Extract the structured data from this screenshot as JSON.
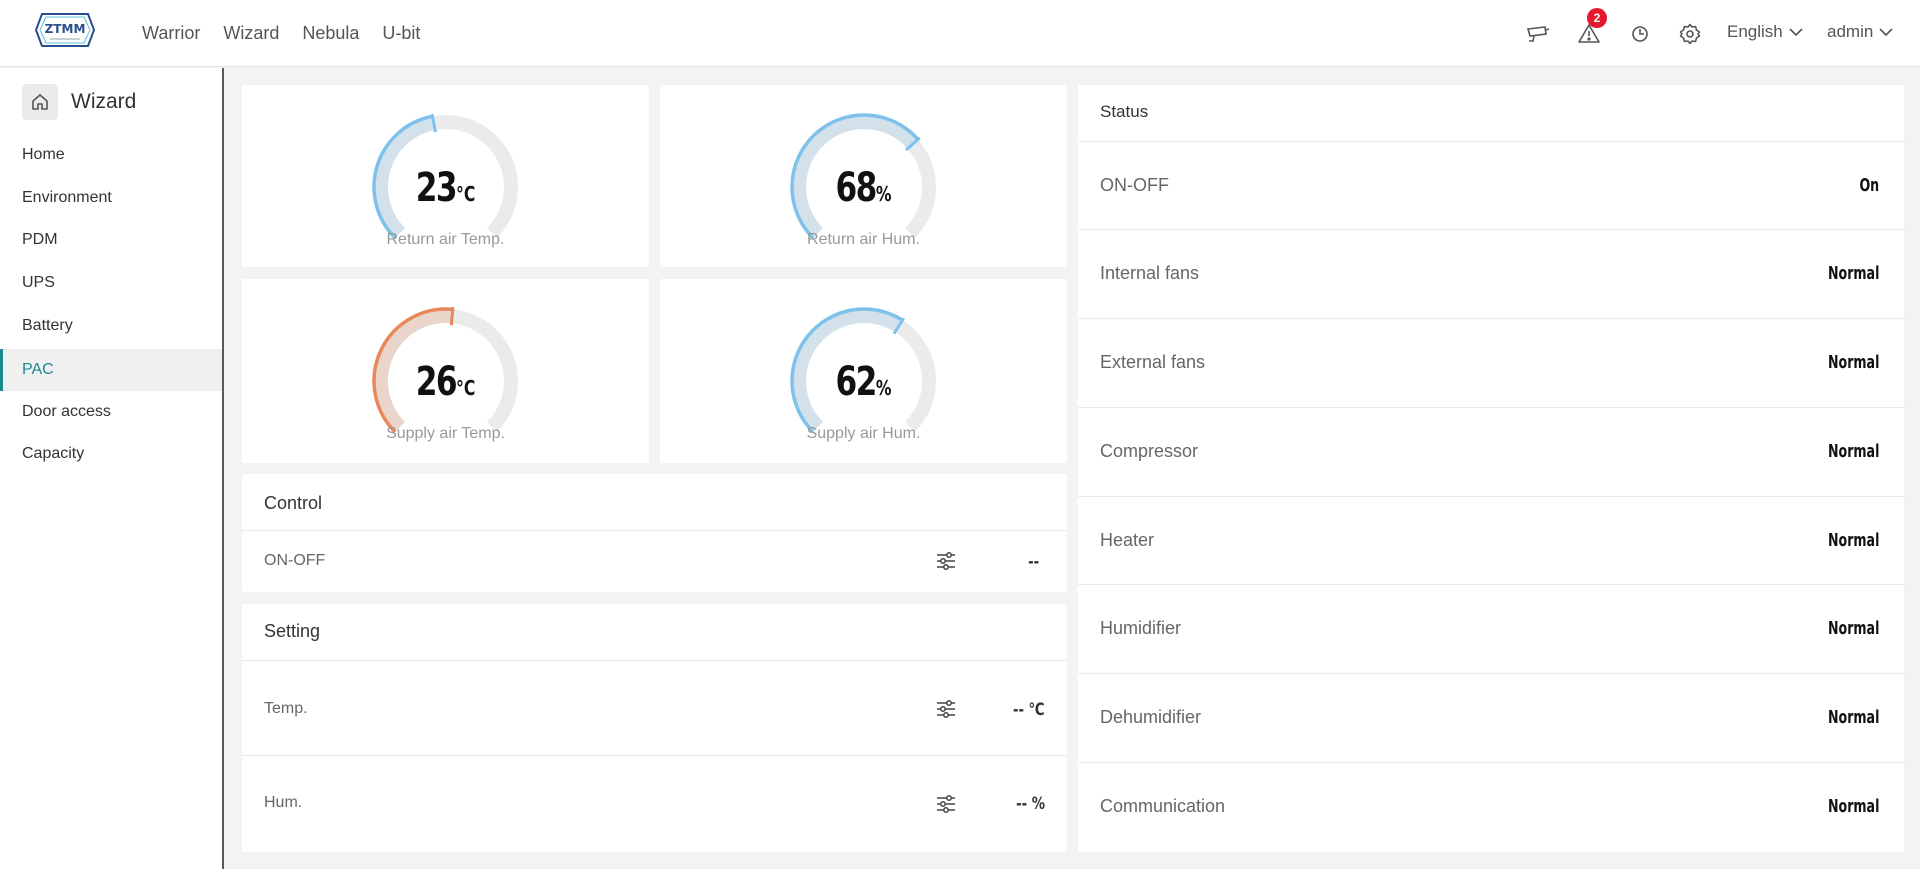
{
  "header": {
    "logo_alt": "ZTMM",
    "nav": [
      "Warrior",
      "Wizard",
      "Nebula",
      "U-bit"
    ],
    "alert_count": "2",
    "language": "English",
    "user": "admin",
    "icons": [
      "camera-icon",
      "alert-icon",
      "clock-icon",
      "gear-icon"
    ]
  },
  "sidebar": {
    "title": "Wizard",
    "items": [
      {
        "label": "Home",
        "active": false
      },
      {
        "label": "Environment",
        "active": false
      },
      {
        "label": "PDM",
        "active": false
      },
      {
        "label": "UPS",
        "active": false
      },
      {
        "label": "Battery",
        "active": false
      },
      {
        "label": "PAC",
        "active": true
      },
      {
        "label": "Door access",
        "active": false
      },
      {
        "label": "Capacity",
        "active": false
      }
    ]
  },
  "gauges": [
    {
      "value": "23",
      "unit": "°C",
      "label": "Return air Temp.",
      "fraction": 0.46,
      "color": "#7ec1ec"
    },
    {
      "value": "68",
      "unit": "%",
      "label": "Return air Hum.",
      "fraction": 0.68,
      "color": "#7ec1ec"
    },
    {
      "value": "26",
      "unit": "°C",
      "label": "Supply air Temp.",
      "fraction": 0.52,
      "color": "#e8875a"
    },
    {
      "value": "62",
      "unit": "%",
      "label": "Supply air Hum.",
      "fraction": 0.62,
      "color": "#7ec1ec"
    }
  ],
  "control": {
    "title": "Control",
    "rows": [
      {
        "label": "ON-OFF",
        "value": "--"
      }
    ]
  },
  "setting": {
    "title": "Setting",
    "rows": [
      {
        "label": "Temp.",
        "value": "-- ℃"
      },
      {
        "label": "Hum.",
        "value": "-- %"
      }
    ]
  },
  "status": {
    "title": "Status",
    "rows": [
      {
        "label": "ON-OFF",
        "value": "On"
      },
      {
        "label": "Internal fans",
        "value": "Normal"
      },
      {
        "label": "External fans",
        "value": "Normal"
      },
      {
        "label": "Compressor",
        "value": "Normal"
      },
      {
        "label": "Heater",
        "value": "Normal"
      },
      {
        "label": "Humidifier",
        "value": "Normal"
      },
      {
        "label": "Dehumidifier",
        "value": "Normal"
      },
      {
        "label": "Communication",
        "value": "Normal"
      }
    ]
  },
  "colors": {
    "accent": "#1d8a93",
    "alert": "#e5182d",
    "gauge_blue": "#7ec1ec",
    "gauge_orange": "#e8875a"
  }
}
